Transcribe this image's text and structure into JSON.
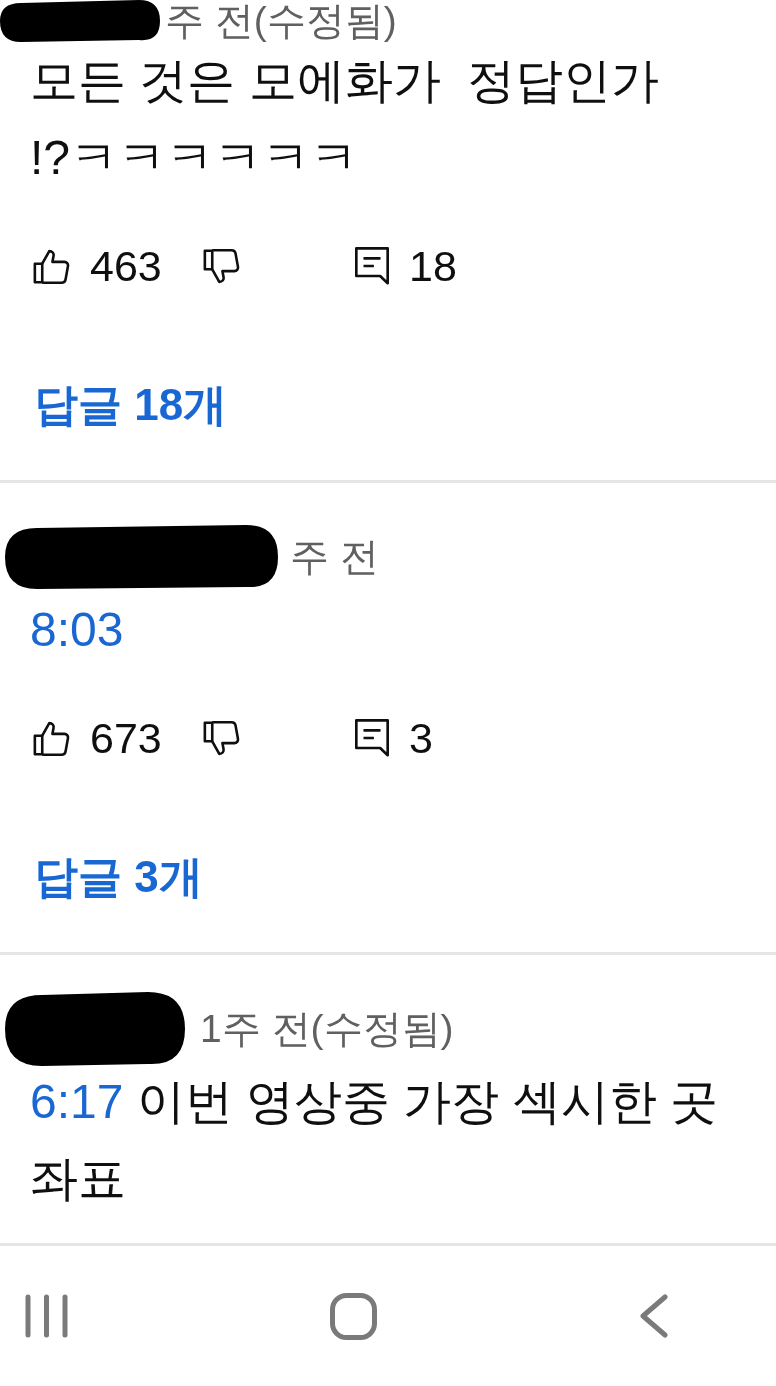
{
  "comments": [
    {
      "meta": "주 전(수정됨)",
      "text": "모든 것은 모에화가  정답인가 !?ㅋㅋㅋㅋㅋㅋ",
      "likes": "463",
      "replies_count": "18",
      "replies_link": "답글 18개"
    },
    {
      "meta": "주 전",
      "timestamp": "8:03",
      "likes": "673",
      "replies_count": "3",
      "replies_link": "답글 3개"
    },
    {
      "meta": "1주 전(수정됨)",
      "timestamp": "6:17",
      "text": "이번 영상중 가장 섹시한 곳 좌표"
    }
  ]
}
